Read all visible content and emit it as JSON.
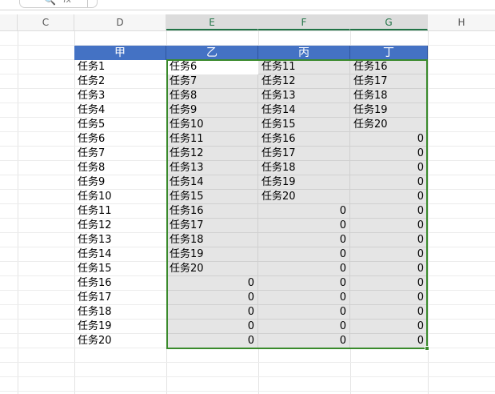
{
  "toolbar": {
    "search_icon": "🔍",
    "fx_label": "fx"
  },
  "columns": [
    "C",
    "D",
    "E",
    "F",
    "G",
    "H"
  ],
  "table": {
    "headers": [
      "甲",
      "乙",
      "丙",
      "丁"
    ],
    "rows": [
      [
        "任务1",
        "任务6",
        "任务11",
        "任务16"
      ],
      [
        "任务2",
        "任务7",
        "任务12",
        "任务17"
      ],
      [
        "任务3",
        "任务8",
        "任务13",
        "任务18"
      ],
      [
        "任务4",
        "任务9",
        "任务14",
        "任务19"
      ],
      [
        "任务5",
        "任务10",
        "任务15",
        "任务20"
      ],
      [
        "任务6",
        "任务11",
        "任务16",
        "0"
      ],
      [
        "任务7",
        "任务12",
        "任务17",
        "0"
      ],
      [
        "任务8",
        "任务13",
        "任务18",
        "0"
      ],
      [
        "任务9",
        "任务14",
        "任务19",
        "0"
      ],
      [
        "任务10",
        "任务15",
        "任务20",
        "0"
      ],
      [
        "任务11",
        "任务16",
        "0",
        "0"
      ],
      [
        "任务12",
        "任务17",
        "0",
        "0"
      ],
      [
        "任务13",
        "任务18",
        "0",
        "0"
      ],
      [
        "任务14",
        "任务19",
        "0",
        "0"
      ],
      [
        "任务15",
        "任务20",
        "0",
        "0"
      ],
      [
        "任务16",
        "0",
        "0",
        "0"
      ],
      [
        "任务17",
        "0",
        "0",
        "0"
      ],
      [
        "任务18",
        "0",
        "0",
        "0"
      ],
      [
        "任务19",
        "0",
        "0",
        "0"
      ],
      [
        "任务20",
        "0",
        "0",
        "0"
      ]
    ]
  },
  "colors": {
    "header_bg": "#4472c4",
    "selection": "#3a8a2c",
    "selected_fill": "#e5e5e5"
  }
}
